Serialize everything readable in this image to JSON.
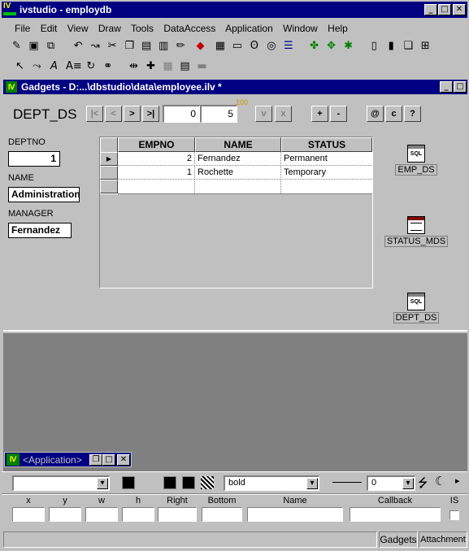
{
  "app": {
    "title": "ivstudio - employdb",
    "logo_text": "IV"
  },
  "menu": [
    "File",
    "Edit",
    "View",
    "Draw",
    "Tools",
    "DataAccess",
    "Application",
    "Window",
    "Help"
  ],
  "gadgets_window": {
    "title": "Gadgets - D:...\\dbstudio\\data\\employee.ilv *"
  },
  "nav": {
    "dataset_label": "DEPT_DS",
    "first": "|<",
    "prev": "<",
    "next": ">",
    "last": ">|",
    "current_value": "0",
    "count_value": "5",
    "max_label": "100",
    "check": "v",
    "cancel": "x",
    "insert": "+",
    "delete": "-",
    "at": "@",
    "c": "c",
    "query": "?"
  },
  "form": {
    "deptno_label": "DEPTNO",
    "deptno_value": "1",
    "name_label": "NAME",
    "name_value": "Administration",
    "manager_label": "MANAGER",
    "manager_value": "Fernandez"
  },
  "grid": {
    "columns": [
      "EMPNO",
      "NAME",
      "STATUS"
    ],
    "rows": [
      {
        "empno": "2",
        "name": "Fernandez",
        "status": "Permanent",
        "current": true
      },
      {
        "empno": "1",
        "name": "Rochette",
        "status": "Temporary",
        "current": false
      }
    ]
  },
  "datasources": [
    {
      "label": "EMP_DS",
      "icon": "sql-table-icon"
    },
    {
      "label": "STATUS_MDS",
      "icon": "memory-table-icon"
    },
    {
      "label": "DEPT_DS",
      "icon": "sql-table-icon"
    }
  ],
  "app_window": {
    "title": "<Application>"
  },
  "inspector": {
    "font_weight_value": "bold",
    "line_width_value": "0",
    "labels": [
      "x",
      "y",
      "w",
      "h",
      "Right",
      "Bottom",
      "Name",
      "Callback",
      "IS"
    ]
  },
  "status_tabs": [
    "Gadgets",
    "Attachment"
  ]
}
